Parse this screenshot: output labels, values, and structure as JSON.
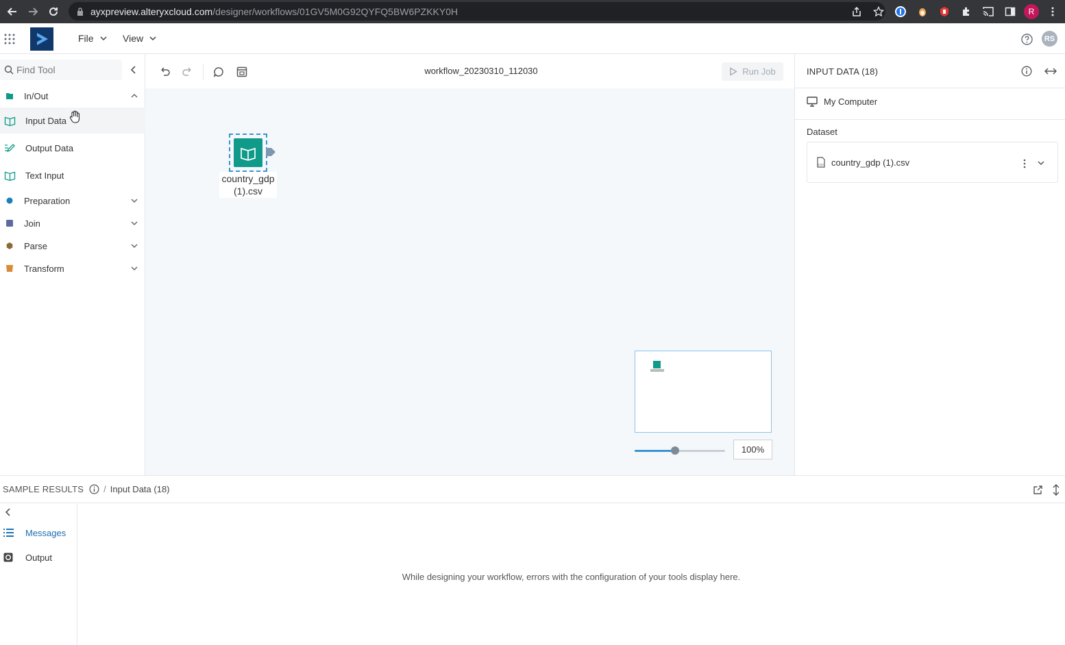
{
  "browser": {
    "url_host": "ayxpreview.alteryxcloud.com",
    "url_path": "/designer/workflows/01GV5M0G92QYFQ5BW6PZKKY0H",
    "profile_initial": "R"
  },
  "appbar": {
    "menus": [
      {
        "label": "File"
      },
      {
        "label": "View"
      }
    ],
    "user_initials": "RS"
  },
  "sidebar": {
    "search_placeholder": "Find Tool",
    "categories": [
      {
        "label": "In/Out",
        "color": "#0f9a8a",
        "expanded": true
      },
      {
        "label": "Preparation",
        "color": "#1b7fb9"
      },
      {
        "label": "Join",
        "color": "#5c6aa0"
      },
      {
        "label": "Parse",
        "color": "#8a6a3a"
      },
      {
        "label": "Transform",
        "color": "#d98b3a"
      }
    ],
    "tools": [
      {
        "label": "Input Data"
      },
      {
        "label": "Output Data"
      },
      {
        "label": "Text Input"
      }
    ]
  },
  "canvas": {
    "workflow_name": "workflow_20230310_112030",
    "run_job_label": "Run Job",
    "node_label": "country_gdp (1).csv",
    "zoom_label": "100%",
    "zoom_fraction": 0.45
  },
  "right_panel": {
    "title": "INPUT DATA (18)",
    "source": "My Computer",
    "dataset_label": "Dataset",
    "file_name": "country_gdp (1).csv"
  },
  "bottom": {
    "title": "SAMPLE RESULTS",
    "crumb_sep": "/",
    "crumb": "Input Data (18)",
    "tabs": [
      {
        "label": "Messages",
        "active": true
      },
      {
        "label": "Output"
      }
    ],
    "message": "While designing your workflow, errors with the configuration of your tools display here."
  }
}
